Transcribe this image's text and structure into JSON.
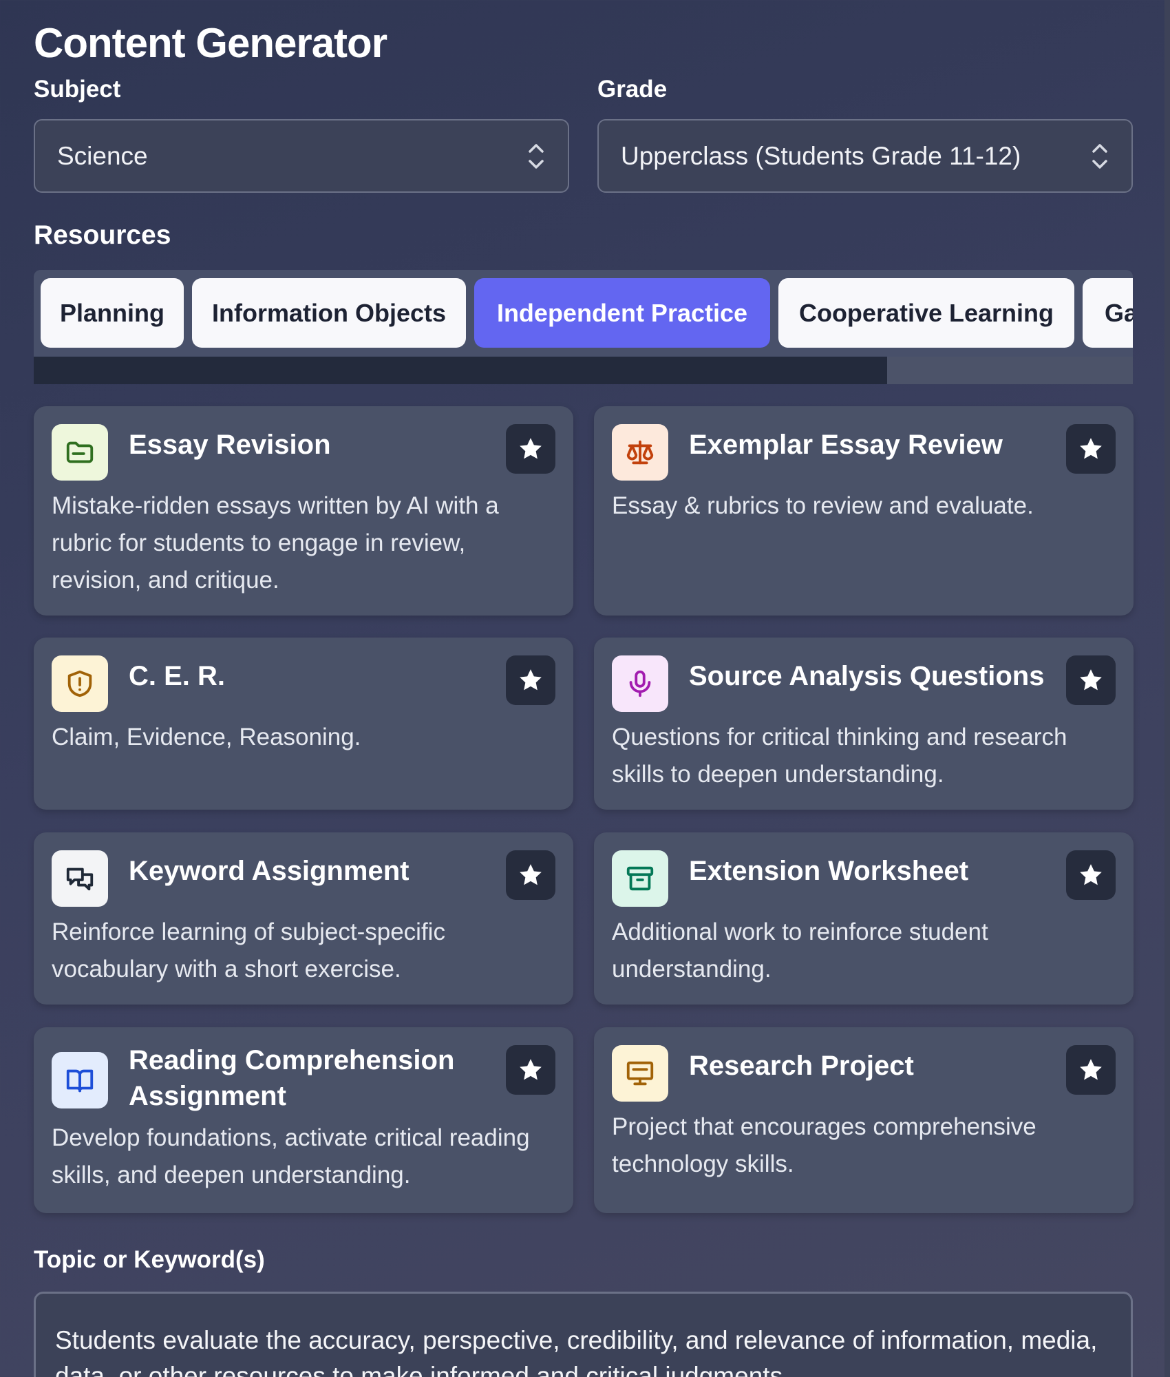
{
  "header": {
    "title": "Content Generator"
  },
  "subject": {
    "label": "Subject",
    "value": "Science"
  },
  "grade": {
    "label": "Grade",
    "value": "Upperclass (Students Grade 11-12)"
  },
  "resources": {
    "title": "Resources",
    "tabs": [
      {
        "label": "Planning",
        "active": false
      },
      {
        "label": "Information Objects",
        "active": false
      },
      {
        "label": "Independent Practice",
        "active": true
      },
      {
        "label": "Cooperative Learning",
        "active": false
      },
      {
        "label": "Ga",
        "active": false
      }
    ]
  },
  "cards": [
    {
      "title": "Essay Revision",
      "description": "Mistake-ridden essays written by AI with a rubric for students to engage in review, revision, and critique.",
      "icon": "folder-icon",
      "icon_color": "#2f6f1f",
      "icon_bg": "#eef7dc"
    },
    {
      "title": "Exemplar Essay Review",
      "description": "Essay & rubrics to review and evaluate.",
      "icon": "scale-icon",
      "icon_color": "#c2410c",
      "icon_bg": "#fde9dc"
    },
    {
      "title": "C. E. R.",
      "description": "Claim, Evidence, Reasoning.",
      "icon": "shield-alert-icon",
      "icon_color": "#a16207",
      "icon_bg": "#fdf3d6"
    },
    {
      "title": "Source Analysis Questions",
      "description": "Questions for critical thinking and research skills to deepen understanding.",
      "icon": "microphone-icon",
      "icon_color": "#a21caf",
      "icon_bg": "#f8e6fb"
    },
    {
      "title": "Keyword Assignment",
      "description": "Reinforce learning of subject-specific vocabulary with a short exercise.",
      "icon": "chat-bubbles-icon",
      "icon_color": "#1f2937",
      "icon_bg": "#f3f4f6"
    },
    {
      "title": "Extension Worksheet",
      "description": "Additional work to reinforce student understanding.",
      "icon": "archive-icon",
      "icon_color": "#047857",
      "icon_bg": "#dcf5ea"
    },
    {
      "title": "Reading Comprehension Assignment",
      "description": "Develop foundations, activate critical reading skills, and deepen understanding.",
      "icon": "open-book-icon",
      "icon_color": "#1d4ed8",
      "icon_bg": "#e3ecfd"
    },
    {
      "title": "Research Project",
      "description": "Project that encourages comprehensive technology skills.",
      "icon": "presentation-icon",
      "icon_color": "#a16207",
      "icon_bg": "#fdf3d6"
    }
  ],
  "topic": {
    "label": "Topic or Keyword(s)",
    "value": "Students evaluate the accuracy, perspective, credibility, and relevance of information, media, data, or other resources to make informed and critical judgments."
  }
}
